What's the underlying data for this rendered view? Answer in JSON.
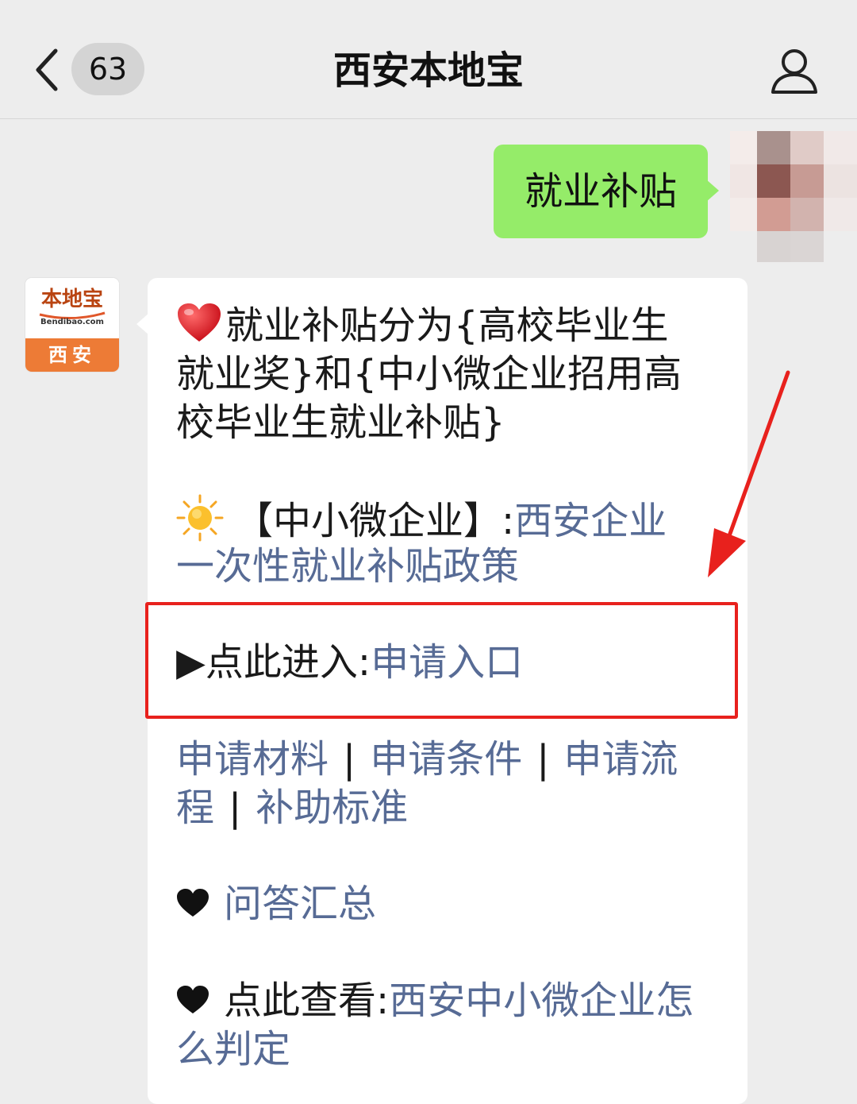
{
  "header": {
    "unread_count": "63",
    "title": "西安本地宝"
  },
  "sent_message": {
    "text": "就业补贴"
  },
  "official_account": {
    "logo_text": "本地宝",
    "logo_domain": "Bendibao.com",
    "city": "西安"
  },
  "message": {
    "intro_line1": "就业补贴分为{高校毕业生",
    "intro_line2": "就业奖}和{中小微企业招用高",
    "intro_line3": "校毕业生就业补贴}",
    "sme_label": "【中小微企业】:",
    "sme_link_line1": "西安企业",
    "sme_link_line2": "一次性就业补贴政策",
    "enter_label": "▶点此进入:",
    "enter_link": "申请入口",
    "links": {
      "materials": "申请材料",
      "conditions": "申请条件",
      "process_part1": "申请流",
      "process_part2": "程",
      "standard": "补助标准",
      "separator": "|"
    },
    "qa_link": "问答汇总",
    "view_label": "点此查看:",
    "view_link_line1": "西安中小微企业怎",
    "view_link_line2": "么判定"
  },
  "colors": {
    "background": "#ededed",
    "sent_bubble": "#95ec69",
    "link": "#576b95",
    "highlight": "#e8211d",
    "oa_orange": "#ed7b36"
  }
}
